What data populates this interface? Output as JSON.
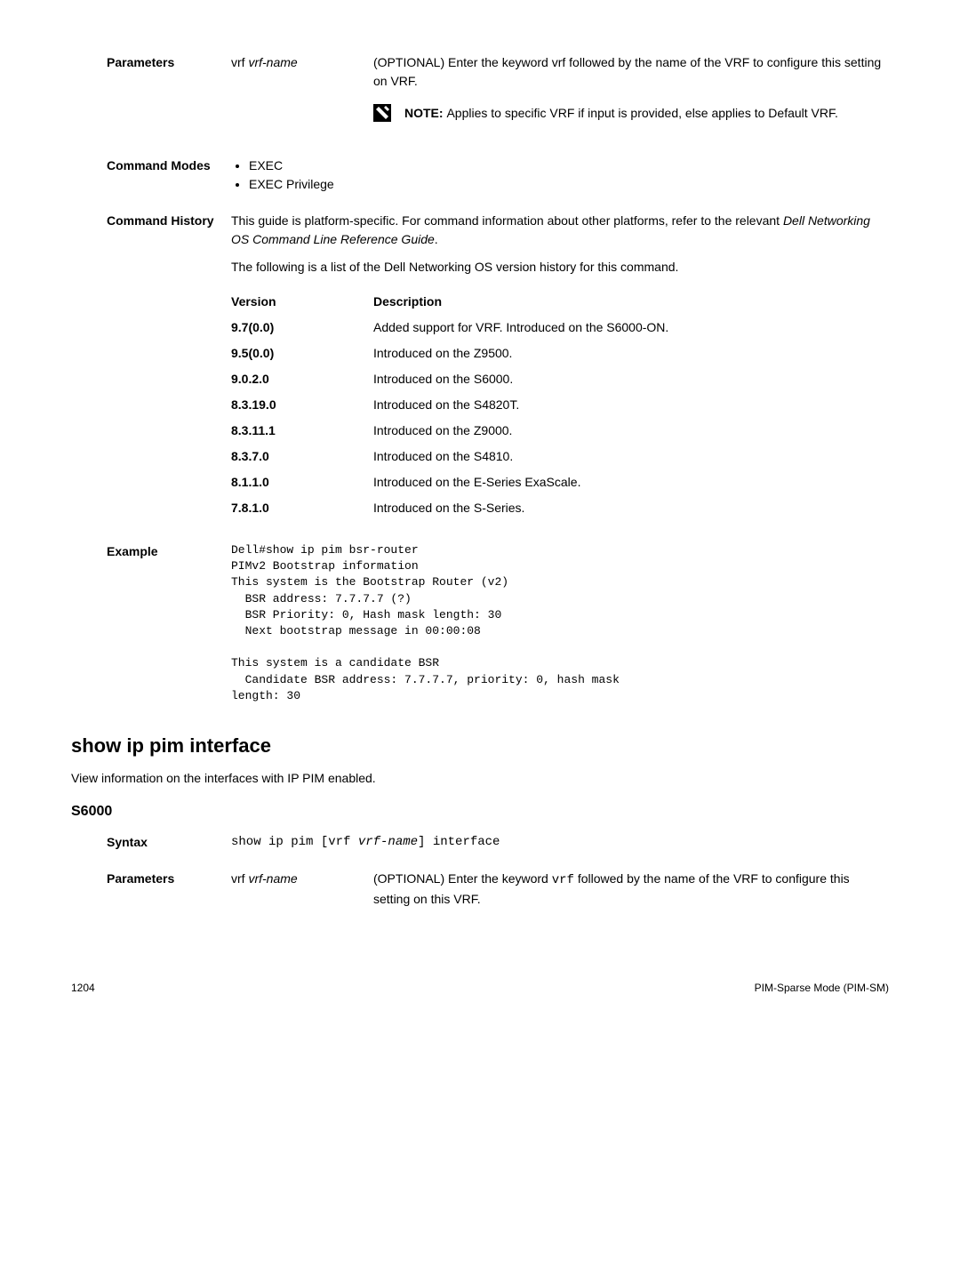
{
  "parameters": {
    "label": "Parameters",
    "param_name_prefix": "vrf ",
    "param_name_var": "vrf-name",
    "param_desc": "(OPTIONAL) Enter the keyword vrf followed by the name of the VRF to configure this setting on VRF.",
    "note_label": "NOTE: ",
    "note_text": "Applies to specific VRF if input is provided, else applies to Default VRF."
  },
  "command_modes": {
    "label": "Command Modes",
    "items": [
      "EXEC",
      "EXEC Privilege"
    ]
  },
  "command_history": {
    "label": "Command History",
    "intro1": "This guide is platform-specific. For command information about other platforms, refer to the relevant ",
    "intro1_italic": "Dell Networking OS Command Line Reference Guide",
    "intro1_end": ".",
    "intro2": "The following is a list of the Dell Networking OS version history for this command.",
    "header_version": "Version",
    "header_desc": "Description",
    "rows": [
      {
        "v": "9.7(0.0)",
        "d": "Added support for VRF. Introduced on the S6000-ON."
      },
      {
        "v": "9.5(0.0)",
        "d": "Introduced on the Z9500."
      },
      {
        "v": "9.0.2.0",
        "d": "Introduced on the S6000."
      },
      {
        "v": "8.3.19.0",
        "d": "Introduced on the S4820T."
      },
      {
        "v": "8.3.11.1",
        "d": "Introduced on the Z9000."
      },
      {
        "v": "8.3.7.0",
        "d": "Introduced on the S4810."
      },
      {
        "v": "8.1.1.0",
        "d": "Introduced on the E-Series ExaScale."
      },
      {
        "v": "7.8.1.0",
        "d": "Introduced on the S-Series."
      }
    ]
  },
  "example": {
    "label": "Example",
    "text": "Dell#show ip pim bsr-router\nPIMv2 Bootstrap information\nThis system is the Bootstrap Router (v2)\n  BSR address: 7.7.7.7 (?)\n  BSR Priority: 0, Hash mask length: 30\n  Next bootstrap message in 00:00:08\n\nThis system is a candidate BSR\n  Candidate BSR address: 7.7.7.7, priority: 0, hash mask\nlength: 30"
  },
  "section2": {
    "heading": "show ip pim interface",
    "intro": "View information on the interfaces with IP PIM enabled.",
    "model": "S6000",
    "syntax_label": "Syntax",
    "syntax_prefix": "show ip pim [vrf ",
    "syntax_var": "vrf-name",
    "syntax_suffix": "] interface",
    "params_label": "Parameters",
    "param_name_prefix": "vrf ",
    "param_name_var": "vrf-name",
    "param_desc_pre": "(OPTIONAL) Enter the keyword ",
    "param_desc_code": "vrf",
    "param_desc_post": " followed by the name of the VRF to configure this setting on this VRF."
  },
  "footer": {
    "page": "1204",
    "section": "PIM-Sparse Mode (PIM-SM)"
  }
}
